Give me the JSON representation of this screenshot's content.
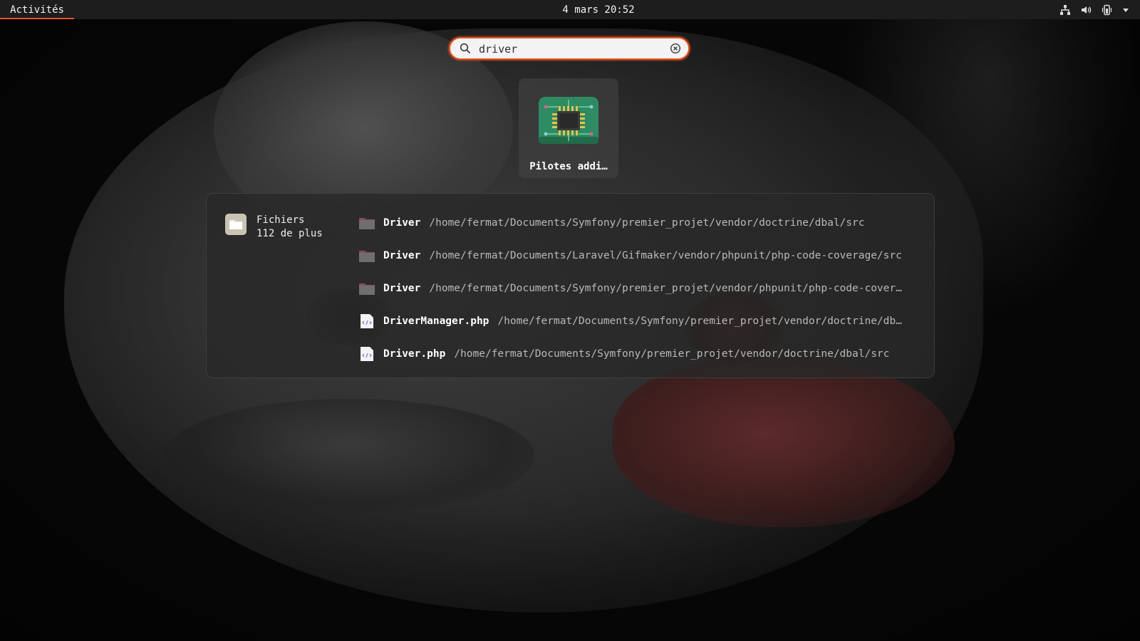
{
  "topbar": {
    "activities_label": "Activités",
    "clock": "4 mars  20:52",
    "tray_icons": [
      "network-wired-icon",
      "volume-icon",
      "phone-battery-icon",
      "menu-arrow-icon"
    ]
  },
  "search": {
    "value": "driver",
    "placeholder": "",
    "search_icon": "search-icon",
    "clear_icon": "clear-icon"
  },
  "apps": [
    {
      "label": "Pilotes addi…",
      "icon": "chip-icon"
    }
  ],
  "files_provider": {
    "name": "Fichiers",
    "more": "112 de plus",
    "icon": "files-app-icon",
    "results": [
      {
        "title": "Driver",
        "path": "/home/fermat/Documents/Symfony/premier_projet/vendor/doctrine/dbal/src",
        "icon": "folder-icon"
      },
      {
        "title": "Driver",
        "path": "/home/fermat/Documents/Laravel/Gifmaker/vendor/phpunit/php-code-coverage/src",
        "icon": "folder-icon"
      },
      {
        "title": "Driver",
        "path": "/home/fermat/Documents/Symfony/premier_projet/vendor/phpunit/php-code-cover…",
        "icon": "folder-icon"
      },
      {
        "title": "DriverManager.php",
        "path": "/home/fermat/Documents/Symfony/premier_projet/vendor/doctrine/db…",
        "icon": "php-file-icon"
      },
      {
        "title": "Driver.php",
        "path": "/home/fermat/Documents/Symfony/premier_projet/vendor/doctrine/dbal/src",
        "icon": "php-file-icon"
      }
    ]
  },
  "colors": {
    "accent": "#e95420",
    "topbar_bg": "#1d1d1d",
    "panel_bg": "#282828",
    "folder": "#8c4a5a"
  }
}
